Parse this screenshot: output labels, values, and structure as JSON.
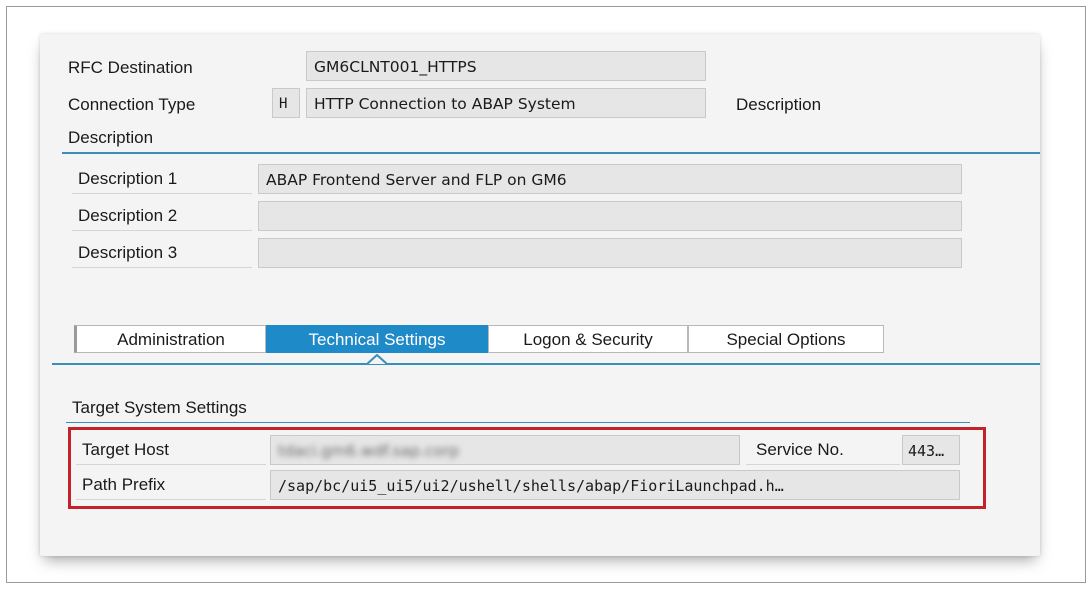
{
  "header": {
    "rfc_destination_label": "RFC Destination",
    "rfc_destination_value": "GM6CLNT001_HTTPS",
    "connection_type_label": "Connection Type",
    "connection_type_code": "H",
    "connection_type_value": "HTTP Connection to ABAP System",
    "description_link": "Description"
  },
  "description_section": {
    "title": "Description",
    "rows": [
      {
        "label": "Description 1",
        "value": "ABAP Frontend Server and FLP on GM6"
      },
      {
        "label": "Description 2",
        "value": ""
      },
      {
        "label": "Description 3",
        "value": ""
      }
    ]
  },
  "tabs": [
    {
      "label": "Administration",
      "active": false
    },
    {
      "label": "Technical Settings",
      "active": true
    },
    {
      "label": "Logon & Security",
      "active": false
    },
    {
      "label": "Special Options",
      "active": false
    }
  ],
  "target_system": {
    "title": "Target System Settings",
    "target_host_label": "Target Host",
    "target_host_value": "tdaci.gm6.wdf.sap.corp",
    "service_no_label": "Service No.",
    "service_no_value": "443…",
    "path_prefix_label": "Path Prefix",
    "path_prefix_value": "/sap/bc/ui5_ui5/ui2/ushell/shells/abap/FioriLaunchpad.h…"
  },
  "colors": {
    "accent": "#1f8ac8",
    "section_line": "#3a8fb7",
    "highlight_box": "#c4222a"
  }
}
